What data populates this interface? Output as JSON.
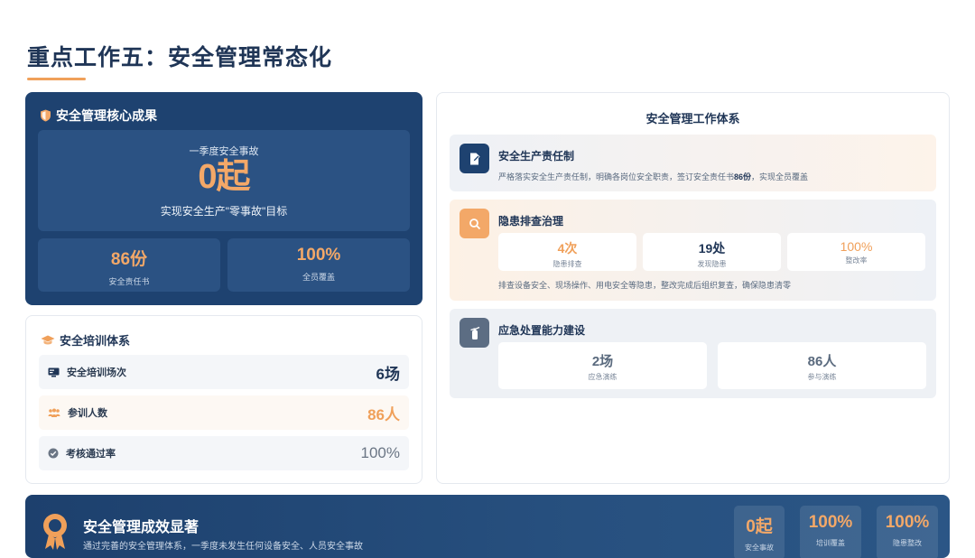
{
  "page": {
    "title": "重点工作五：安全管理常态化"
  },
  "core": {
    "heading": "安全管理核心成果",
    "main_sub": "一季度安全事故",
    "main_value": "0起",
    "main_goal": "实现安全生产\"零事故\"目标",
    "stats": [
      {
        "value": "86份",
        "label": "安全责任书"
      },
      {
        "value": "100%",
        "label": "全员覆盖"
      }
    ]
  },
  "training": {
    "heading": "安全培训体系",
    "rows": [
      {
        "icon": "training-board-icon",
        "label": "安全培训场次",
        "value": "6场",
        "color": "#1f3556"
      },
      {
        "icon": "people-icon",
        "label": "参训人数",
        "value": "86人",
        "color": "#f0a05a"
      },
      {
        "icon": "check-circle-icon",
        "label": "考核通过率",
        "value": "100%",
        "color": "#6b7685"
      }
    ]
  },
  "system": {
    "title": "安全管理工作体系",
    "responsibility": {
      "heading": "安全生产责任制",
      "desc_pre": "严格落实安全生产责任制，明确各岗位安全职责，签订安全责任书",
      "desc_bold": "86份",
      "desc_post": "，实现全员覆盖"
    },
    "hazard": {
      "heading": "隐患排查治理",
      "stats": [
        {
          "value": "4次",
          "label": "隐患排查",
          "color": "#f0a05a"
        },
        {
          "value": "19处",
          "label": "发现隐患",
          "color": "#1f3556"
        },
        {
          "value": "100%",
          "label": "整改率",
          "color": "#f0a05a"
        }
      ],
      "desc": "排查设备安全、现场操作、用电安全等隐患，整改完成后组织复查，确保隐患清零"
    },
    "emergency": {
      "heading": "应急处置能力建设",
      "stats": [
        {
          "value": "2场",
          "label": "应急演练"
        },
        {
          "value": "86人",
          "label": "参与演练"
        }
      ]
    }
  },
  "banner": {
    "title": "安全管理成效显著",
    "desc": "通过完善的安全管理体系，一季度未发生任何设备安全、人员安全事故",
    "stats": [
      {
        "value": "0起",
        "label": "安全事故"
      },
      {
        "value": "100%",
        "label": "培训覆盖"
      },
      {
        "value": "100%",
        "label": "隐患整改"
      }
    ]
  },
  "colors": {
    "navy": "#1e4270",
    "accent": "#f0a05a"
  }
}
